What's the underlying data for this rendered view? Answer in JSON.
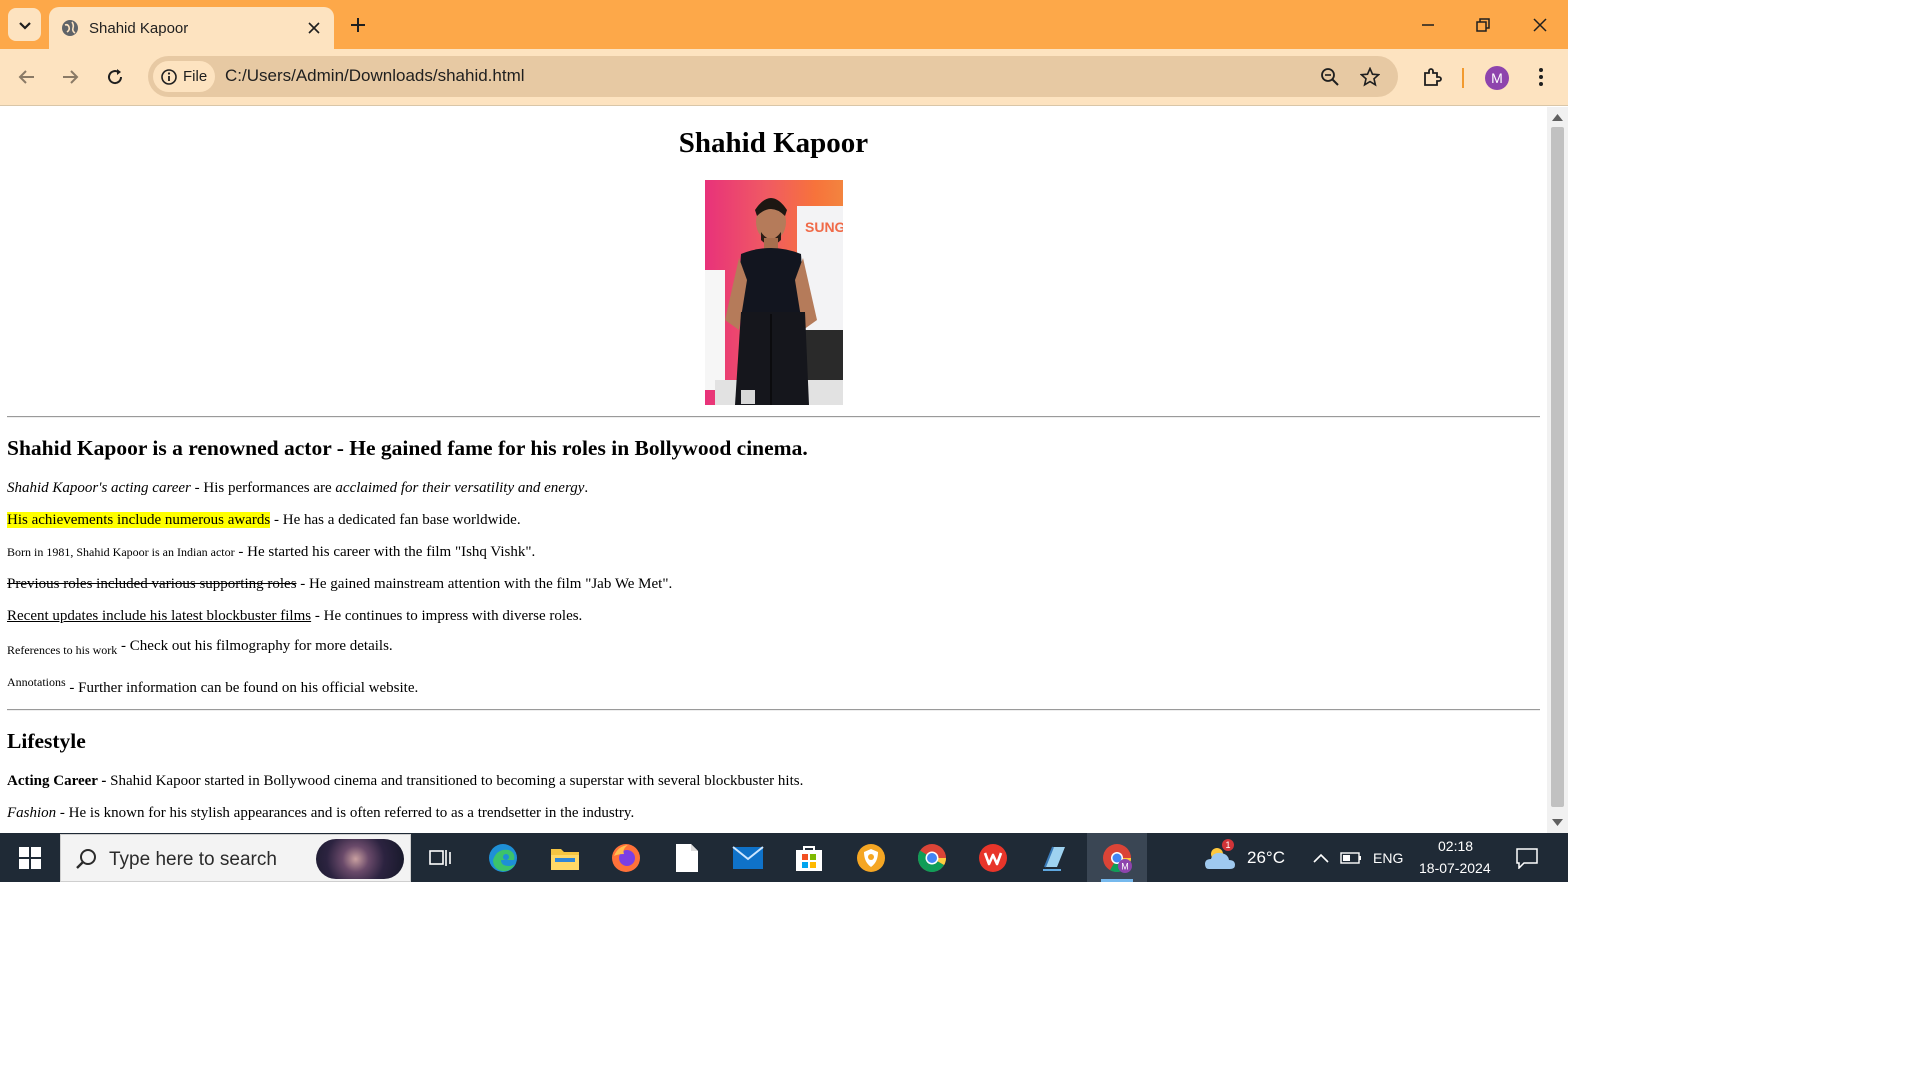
{
  "browser": {
    "tab_title": "Shahid Kapoor",
    "site_chip_label": "File",
    "url": "C:/Users/Admin/Downloads/shahid.html",
    "profile_initial": "M",
    "theme_color": "#fda849"
  },
  "page": {
    "title": "Shahid Kapoor",
    "portrait_alt": "Shahid Kapoor",
    "heading": "Shahid Kapoor is a renowned actor - He gained fame for his roles in Bollywood cinema.",
    "lines": [
      {
        "lead": "Shahid Kapoor's acting career",
        "sep": " - ",
        "rest_a": "His performances are ",
        "rest_em": "acclaimed for their versatility and energy",
        "rest_b": "."
      },
      {
        "lead": "His achievements include numerous awards",
        "sep": " - ",
        "rest": "He has a dedicated fan base worldwide."
      },
      {
        "lead": "Born in 1981, Shahid Kapoor is an Indian actor",
        "sep": " - ",
        "rest": "He started his career with the film \"Ishq Vishk\"."
      },
      {
        "lead": "Previous roles included various supporting roles",
        "sep": " - ",
        "rest": "He gained mainstream attention with the film \"Jab We Met\"."
      },
      {
        "lead": "Recent updates include his latest blockbuster films",
        "sep": " - ",
        "rest": "He continues to impress with diverse roles."
      },
      {
        "lead": "References to his work",
        "sep": " - ",
        "rest": "Check out his filmography for more details."
      },
      {
        "lead": "Annotations",
        "sep": " - ",
        "rest": "Further information can be found on his official website."
      }
    ],
    "lifestyle": {
      "heading": "Lifestyle",
      "items": [
        {
          "lead": "Acting Career",
          "sep": " - ",
          "rest": "Shahid Kapoor started in Bollywood cinema and transitioned to becoming a superstar with several blockbuster hits."
        },
        {
          "lead": "Fashion",
          "sep": " - ",
          "rest": "He is known for his stylish appearances and is often referred to as a trendsetter in the industry."
        }
      ]
    }
  },
  "taskbar": {
    "search_placeholder": "Type here to search",
    "weather_temp": "26°C",
    "weather_badge": "1",
    "language": "ENG",
    "time": "02:18",
    "date": "18-07-2024"
  }
}
